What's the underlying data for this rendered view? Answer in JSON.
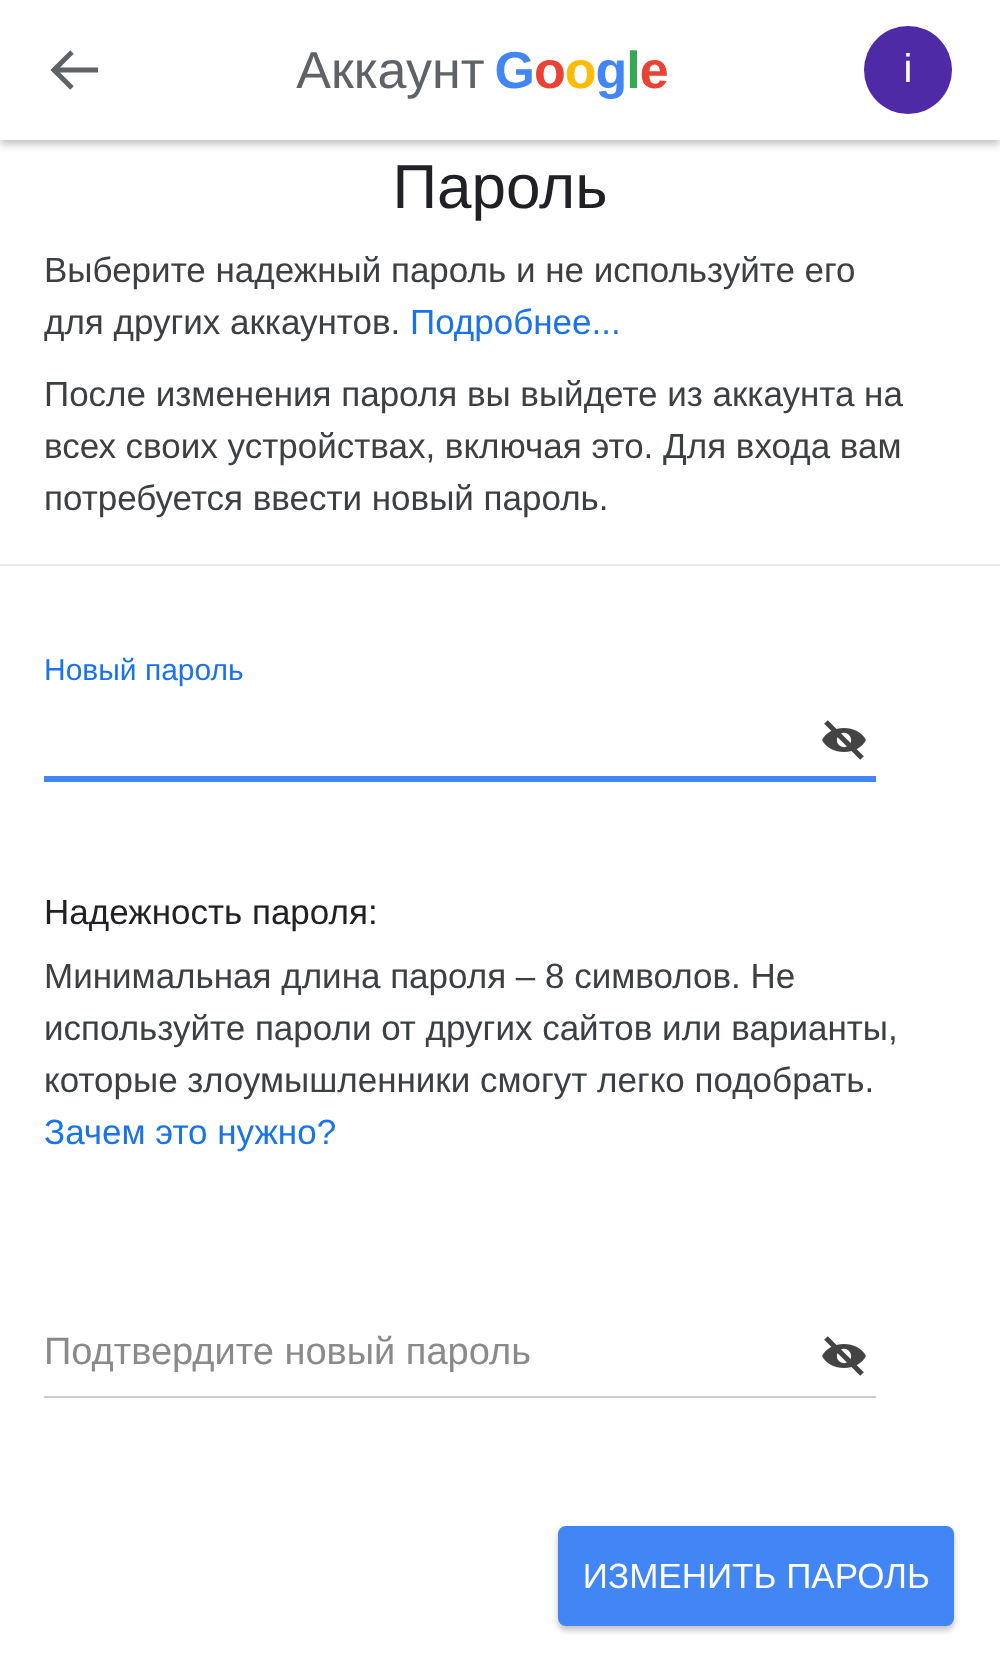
{
  "header": {
    "account_word": "Аккаунт",
    "logo_letters": [
      {
        "text": "G",
        "color": "#4285f4"
      },
      {
        "text": "o",
        "color": "#ea4335"
      },
      {
        "text": "o",
        "color": "#fbbc05"
      },
      {
        "text": "g",
        "color": "#4285f4"
      },
      {
        "text": "l",
        "color": "#34a853"
      },
      {
        "text": "e",
        "color": "#ea4335"
      }
    ],
    "avatar_letter": "i"
  },
  "title": "Пароль",
  "intro": "Выберите надежный пароль и не используйте его для других аккаунтов.",
  "intro_link": "Подробнее...",
  "notice": "После изменения пароля вы выйдете из аккаунта на всех своих устройствах, включая это. Для входа вам потребуется ввести новый пароль.",
  "new_password": {
    "label": "Новый пароль",
    "focused": true,
    "visible": false
  },
  "strength": {
    "heading": "Надежность пароля:",
    "text": "Минимальная длина пароля – 8 символов. Не используйте пароли от других сайтов или варианты, которые злоумышленники смогут легко подобрать.",
    "link": "Зачем это нужно?"
  },
  "confirm_password": {
    "placeholder": "Подтвердите новый пароль",
    "focused": false,
    "visible": false
  },
  "submit_button": "ИЗМЕНИТЬ ПАРОЛЬ"
}
